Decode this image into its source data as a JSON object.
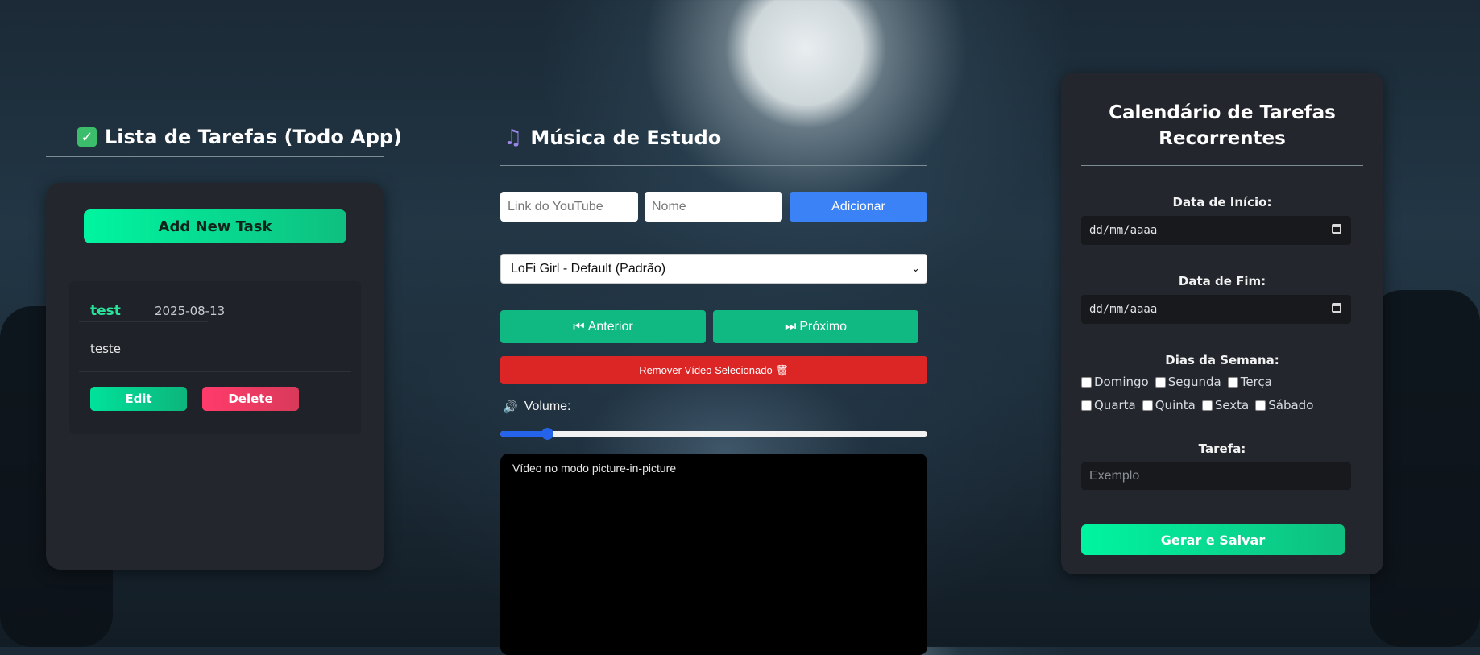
{
  "todo": {
    "title": "Lista de Tarefas (Todo App)",
    "title_icon": "check-box-icon",
    "add_button": "Add New Task",
    "tasks": [
      {
        "name": "test",
        "date": "2025-08-13",
        "description": "teste",
        "edit_label": "Edit",
        "delete_label": "Delete"
      }
    ]
  },
  "music": {
    "title": "Música de Estudo",
    "title_icon": "music-note-icon",
    "link_placeholder": "Link do YouTube",
    "name_placeholder": "Nome",
    "add_button": "Adicionar",
    "selected_video": "LoFi Girl - Default (Padrão)",
    "prev_label": "Anterior",
    "next_label": "Próximo",
    "remove_label": "Remover Vídeo Selecionado 🗑",
    "volume_label": "Volume:",
    "volume_fraction": 0.11,
    "video_text": "Vídeo no modo picture-in-picture"
  },
  "calendar": {
    "title_line1": "Calendário de Tarefas",
    "title_line2": "Recorrentes",
    "start_label": "Data de Início:",
    "start_value": "dd/mm/aaaa",
    "end_label": "Data de Fim:",
    "end_value": "dd/mm/aaaa",
    "days_label": "Dias da Semana:",
    "days_row1": [
      "Domingo",
      "Segunda",
      "Terça"
    ],
    "days_row2": [
      "Quarta",
      "Quinta",
      "Sexta",
      "Sábado"
    ],
    "task_label": "Tarefa:",
    "task_placeholder": "Exemplo",
    "save_button": "Gerar e Salvar"
  },
  "colors": {
    "accent_green": "#10b981",
    "accent_blue": "#3b82f6",
    "danger_red": "#dc2626",
    "panel_bg": "#23262d"
  }
}
